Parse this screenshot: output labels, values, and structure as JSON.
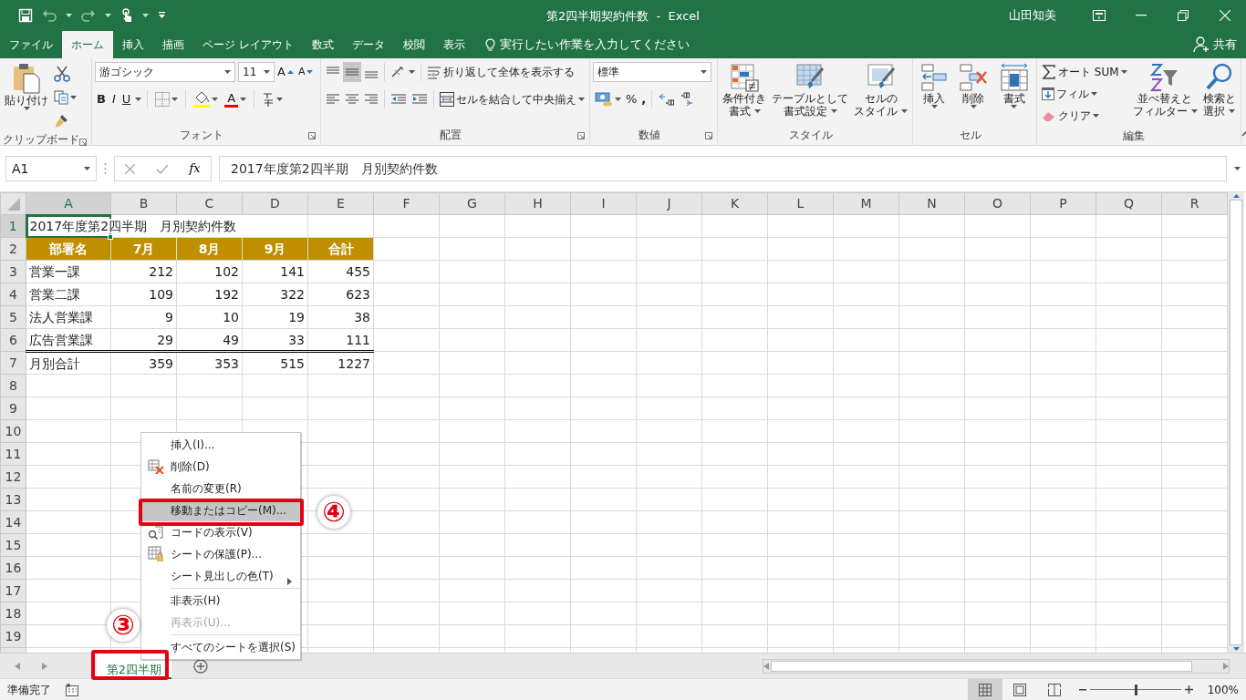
{
  "title_bar": {
    "title": "第2四半期契約件数  -  Excel",
    "user": "山田知美"
  },
  "tabs": [
    {
      "label": "ファイル",
      "selected": false
    },
    {
      "label": "ホーム",
      "selected": true
    },
    {
      "label": "挿入",
      "selected": false
    },
    {
      "label": "描画",
      "selected": false
    },
    {
      "label": "ページ レイアウト",
      "selected": false
    },
    {
      "label": "数式",
      "selected": false
    },
    {
      "label": "データ",
      "selected": false
    },
    {
      "label": "校閲",
      "selected": false
    },
    {
      "label": "表示",
      "selected": false
    }
  ],
  "tell_me": "実行したい作業を入力してください",
  "share": "共有",
  "ribbon": {
    "clipboard": {
      "label": "クリップボード",
      "paste": "貼り付け"
    },
    "font": {
      "label": "フォント",
      "name": "游ゴシック",
      "size": "11",
      "grow": "A",
      "shrink": "A",
      "bold": "B",
      "italic": "I",
      "underline": "U",
      "color_button": "A"
    },
    "alignment": {
      "label": "配置",
      "wrap": "折り返して全体を表示する",
      "merge": "セルを結合して中央揃え",
      "vertical": [
        {
          "selected": false
        },
        {
          "selected": true
        },
        {
          "selected": false
        }
      ]
    },
    "number": {
      "label": "数値",
      "format": "標準",
      "percent": "%",
      "comma": ","
    },
    "styles": {
      "label": "スタイル",
      "conditional": [
        "条件付き",
        "書式"
      ],
      "table": [
        "テーブルとして",
        "書式設定"
      ],
      "cell": [
        "セルの",
        "スタイル"
      ]
    },
    "cells": {
      "label": "セル",
      "insert": "挿入",
      "delete": "削除",
      "format": "書式"
    },
    "editing": {
      "label": "編集",
      "autosum": "オート SUM",
      "fill": "フィル",
      "clear": "クリア",
      "sort": [
        "並べ替えと",
        "フィルター"
      ],
      "find": [
        "検索と",
        "選択"
      ]
    }
  },
  "formula_bar": {
    "name_box": "A1",
    "function_label": "fx",
    "formula": "2017年度第2四半期　月別契約件数"
  },
  "sheet": {
    "columns": [
      {
        "label": "A",
        "selected": true
      },
      {
        "label": "B",
        "selected": false
      },
      {
        "label": "C",
        "selected": false
      },
      {
        "label": "D",
        "selected": false
      },
      {
        "label": "E",
        "selected": false
      },
      {
        "label": "F",
        "selected": false
      },
      {
        "label": "G",
        "selected": false
      },
      {
        "label": "H",
        "selected": false
      },
      {
        "label": "I",
        "selected": false
      },
      {
        "label": "J",
        "selected": false
      },
      {
        "label": "K",
        "selected": false
      },
      {
        "label": "L",
        "selected": false
      },
      {
        "label": "M",
        "selected": false
      },
      {
        "label": "N",
        "selected": false
      },
      {
        "label": "O",
        "selected": false
      },
      {
        "label": "P",
        "selected": false
      },
      {
        "label": "Q",
        "selected": false
      },
      {
        "label": "R",
        "selected": false
      }
    ],
    "rows": [
      {
        "number": "1",
        "selected": true,
        "kind": "title",
        "cells": [
          "2017年度第2四半期　月別契約件数"
        ]
      },
      {
        "number": "2",
        "selected": false,
        "kind": "header",
        "cells": [
          "部署名",
          "7月",
          "8月",
          "9月",
          "合計"
        ]
      },
      {
        "number": "3",
        "selected": false,
        "kind": "data",
        "cells": [
          "営業一課",
          "212",
          "102",
          "141",
          "455"
        ]
      },
      {
        "number": "4",
        "selected": false,
        "kind": "data",
        "cells": [
          "営業二課",
          "109",
          "192",
          "322",
          "623"
        ]
      },
      {
        "number": "5",
        "selected": false,
        "kind": "data",
        "cells": [
          "法人営業課",
          "9",
          "10",
          "19",
          "38"
        ]
      },
      {
        "number": "6",
        "selected": false,
        "kind": "data",
        "cells": [
          "広告営業課",
          "29",
          "49",
          "33",
          "111"
        ]
      },
      {
        "number": "7",
        "selected": false,
        "kind": "total",
        "cells": [
          "月別合計",
          "359",
          "353",
          "515",
          "1227"
        ]
      },
      {
        "number": "8",
        "selected": false,
        "kind": "empty"
      },
      {
        "number": "9",
        "selected": false,
        "kind": "empty"
      },
      {
        "number": "10",
        "selected": false,
        "kind": "empty"
      },
      {
        "number": "11",
        "selected": false,
        "kind": "empty"
      },
      {
        "number": "12",
        "selected": false,
        "kind": "empty"
      },
      {
        "number": "13",
        "selected": false,
        "kind": "empty"
      },
      {
        "number": "14",
        "selected": false,
        "kind": "empty"
      },
      {
        "number": "15",
        "selected": false,
        "kind": "empty"
      },
      {
        "number": "16",
        "selected": false,
        "kind": "empty"
      },
      {
        "number": "17",
        "selected": false,
        "kind": "empty"
      },
      {
        "number": "18",
        "selected": false,
        "kind": "empty"
      },
      {
        "number": "19",
        "selected": false,
        "kind": "empty"
      }
    ]
  },
  "context_menu": {
    "items": [
      {
        "label": "挿入(I)...",
        "kind": "plain",
        "selected": false,
        "disabled": false,
        "separator_before": false
      },
      {
        "label": "削除(D)",
        "kind": "delete",
        "selected": false,
        "disabled": false,
        "separator_before": false
      },
      {
        "label": "名前の変更(R)",
        "kind": "plain",
        "selected": false,
        "disabled": false,
        "separator_before": false
      },
      {
        "label": "移動またはコピー(M)...",
        "kind": "plain",
        "selected": true,
        "disabled": false,
        "separator_before": false
      },
      {
        "label": "コードの表示(V)",
        "kind": "code",
        "selected": false,
        "disabled": false,
        "separator_before": false
      },
      {
        "label": "シートの保護(P)...",
        "kind": "protect",
        "selected": false,
        "disabled": false,
        "separator_before": false
      },
      {
        "label": "シート見出しの色(T)",
        "kind": "submenu",
        "selected": false,
        "disabled": false,
        "separator_before": false
      },
      {
        "label": "非表示(H)",
        "kind": "plain",
        "selected": false,
        "disabled": false,
        "separator_before": true
      },
      {
        "label": "再表示(U)...",
        "kind": "plain",
        "selected": false,
        "disabled": true,
        "separator_before": false
      },
      {
        "label": "すべてのシートを選択(S)",
        "kind": "plain",
        "selected": false,
        "disabled": false,
        "separator_before": true
      }
    ]
  },
  "sheet_tabs": [
    {
      "label": "第2四半期",
      "selected": true
    }
  ],
  "callouts": [
    {
      "number": "③"
    },
    {
      "number": "④"
    }
  ],
  "status_bar": {
    "status": "準備完了",
    "views": [
      {
        "selected": true
      },
      {
        "selected": false
      },
      {
        "selected": false
      }
    ],
    "zoom": "100%",
    "level": 0.5
  }
}
